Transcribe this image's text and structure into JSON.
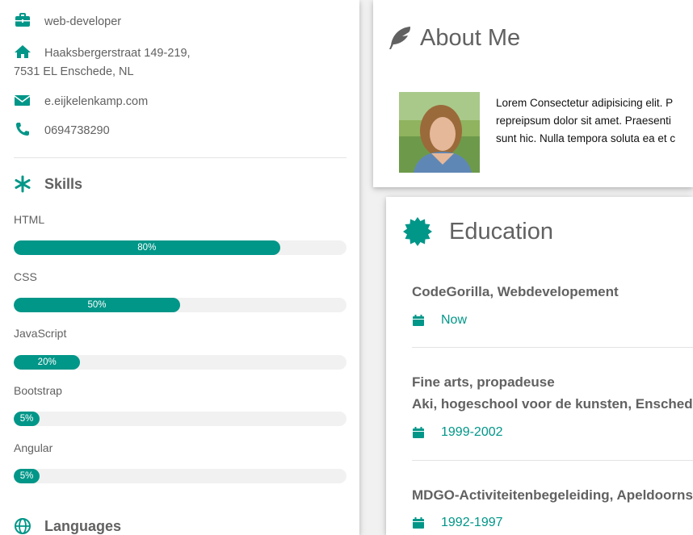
{
  "sidebar": {
    "job": "web-developer",
    "address_line1": "Haaksbergerstraat 149-219,",
    "address_line2": "7531 EL Enschede, NL",
    "email": "e.eijkelenkamp.com",
    "phone": "0694738290",
    "skills_title": "Skills",
    "skills": [
      {
        "name": "HTML",
        "percent": 80,
        "label": "80%"
      },
      {
        "name": "CSS",
        "percent": 50,
        "label": "50%"
      },
      {
        "name": "JavaScript",
        "percent": 20,
        "label": "20%"
      },
      {
        "name": "Bootstrap",
        "percent": 5,
        "label": "5%"
      },
      {
        "name": "Angular",
        "percent": 5,
        "label": "5%"
      }
    ],
    "languages_title": "Languages"
  },
  "about": {
    "title": "About Me",
    "text_lines": [
      "Lorem Consectetur adipisicing elit. P",
      "repreipsum dolor sit amet. Praesenti",
      "sunt hic. Nulla tempora soluta ea et c"
    ]
  },
  "education": {
    "title": "Education",
    "entries": [
      {
        "line1": "CodeGorilla, Webdevelopement",
        "line2": "",
        "date": "Now"
      },
      {
        "line1": "Fine arts, propadeuse",
        "line2": "Aki, hogeschool voor de kunsten, Enschede",
        "date": "1999-2002"
      },
      {
        "line1": "MDGO-Activiteitenbegeleiding, Apeldoorns",
        "line2": "",
        "date": "1992-1997"
      }
    ]
  },
  "colors": {
    "accent": "#009688",
    "text": "#616161",
    "track": "#f1f1f1"
  },
  "icons": [
    "briefcase-icon",
    "home-icon",
    "envelope-icon",
    "phone-icon",
    "asterisk-icon",
    "globe-icon",
    "feather-icon",
    "certificate-icon",
    "calendar-icon"
  ]
}
